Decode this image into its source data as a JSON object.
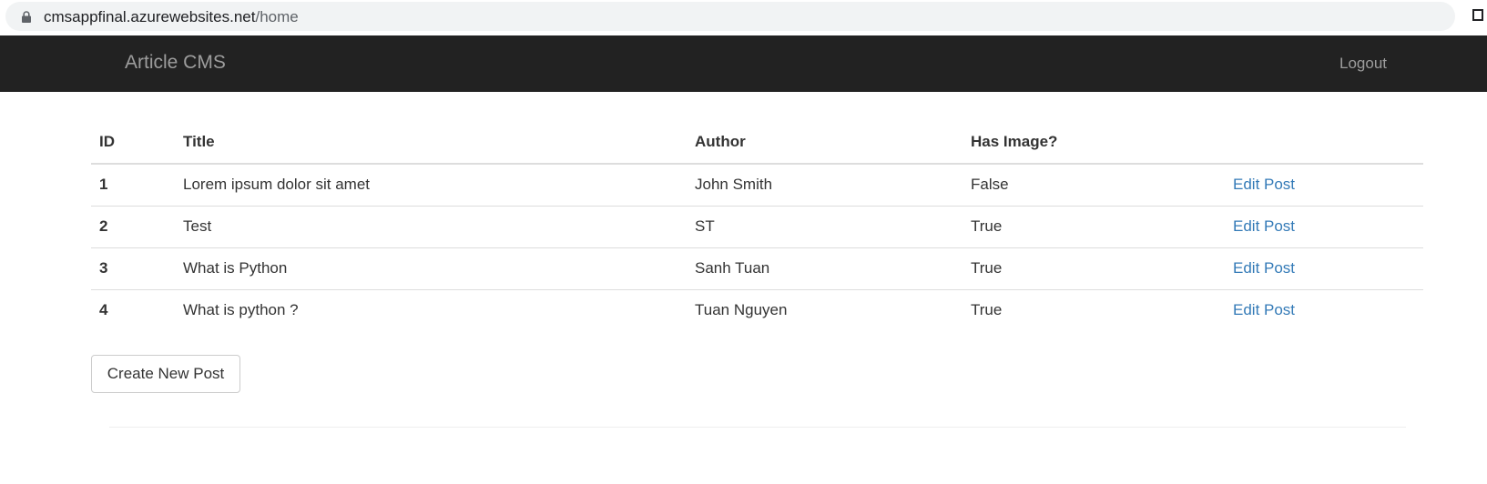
{
  "browser": {
    "url_host": "cmsappfinal.azurewebsites.net",
    "url_path": "/home",
    "lock_icon": "lock-icon"
  },
  "navbar": {
    "brand": "Article CMS",
    "logout_label": "Logout"
  },
  "table": {
    "headers": [
      "ID",
      "Title",
      "Author",
      "Has Image?",
      ""
    ],
    "rows": [
      {
        "id": "1",
        "title": "Lorem ipsum dolor sit amet",
        "author": "John Smith",
        "has_image": "False",
        "action": "Edit Post"
      },
      {
        "id": "2",
        "title": "Test",
        "author": "ST",
        "has_image": "True",
        "action": "Edit Post"
      },
      {
        "id": "3",
        "title": "What is Python",
        "author": "Sanh Tuan",
        "has_image": "True",
        "action": "Edit Post"
      },
      {
        "id": "4",
        "title": "What is python ?",
        "author": "Tuan Nguyen",
        "has_image": "True",
        "action": "Edit Post"
      }
    ]
  },
  "actions": {
    "create_label": "Create New Post"
  },
  "colors": {
    "navbar_bg": "#222222",
    "nav_text": "#9d9d9d",
    "link": "#337ab7"
  }
}
